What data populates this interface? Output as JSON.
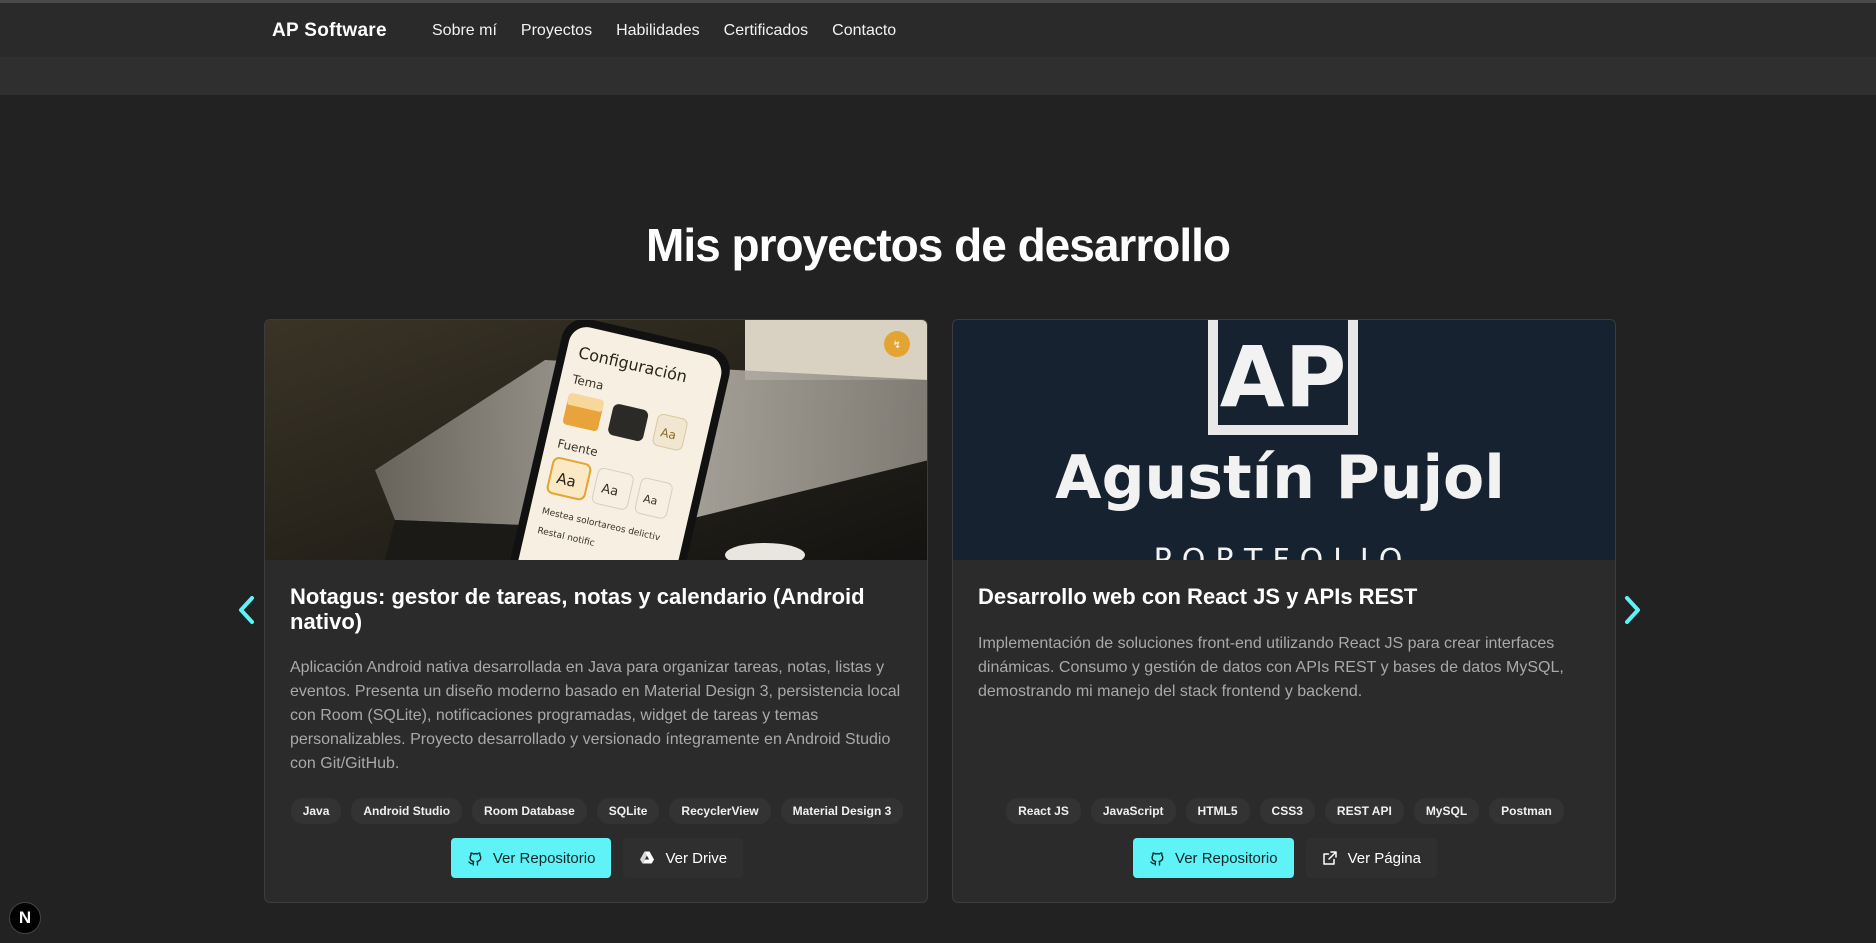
{
  "header": {
    "brand": "AP Software",
    "nav": [
      "Sobre mí",
      "Proyectos",
      "Habilidades",
      "Certificados",
      "Contacto"
    ]
  },
  "section": {
    "title": "Mis proyectos de desarrollo"
  },
  "projects": [
    {
      "title": "Notagus: gestor de tareas, notas y calendario (Android nativo)",
      "image": {
        "screen_title": "Configuración",
        "theme_label": "Tema",
        "font_label": "Fuente",
        "font_sample": "Aa",
        "theme_sample": "Aa",
        "footer_line1": "Mestea solortareos delictiv",
        "footer_line2": "Restal notific"
      },
      "description": "Aplicación Android nativa desarrollada en Java para organizar tareas, notas, listas y eventos. Presenta un diseño moderno basado en Material Design 3, persistencia local con Room (SQLite), notificaciones programadas, widget de tareas y temas personalizables. Proyecto desarrollado y versionado íntegramente en Android Studio con Git/GitHub.",
      "tags": [
        "Java",
        "Android Studio",
        "Room Database",
        "SQLite",
        "RecyclerView",
        "Material Design 3"
      ],
      "buttons": {
        "primary": "Ver Repositorio",
        "secondary": "Ver Drive"
      }
    },
    {
      "title": "Desarrollo web con React JS y APIs REST",
      "image": {
        "logo": "AP",
        "name": "Agustín Pujol",
        "subtitle": "PORTFOLIO"
      },
      "description": "Implementación de soluciones front-end utilizando React JS para crear interfaces dinámicas. Consumo y gestión de datos con APIs REST y bases de datos MySQL, demostrando mi manejo del stack frontend y backend.",
      "tags": [
        "React JS",
        "JavaScript",
        "HTML5",
        "CSS3",
        "REST API",
        "MySQL",
        "Postman"
      ],
      "buttons": {
        "primary": "Ver Repositorio",
        "secondary": "Ver Página"
      }
    }
  ],
  "badge": "N",
  "colors": {
    "background": "#222222",
    "accent": "#5ff2f7",
    "card": "#2b2b2b"
  }
}
